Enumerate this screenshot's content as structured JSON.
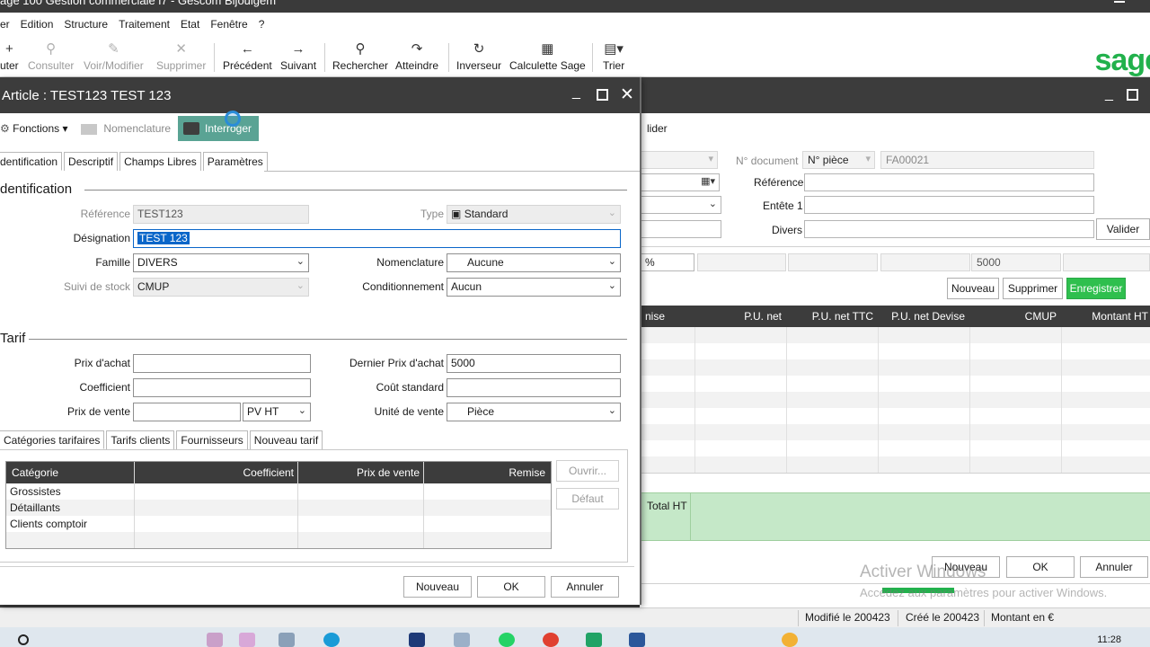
{
  "app": {
    "title": "age 100 Gestion commerciale i7 - Gescom Bijouigem"
  },
  "menu": [
    "er",
    "Edition",
    "Structure",
    "Traitement",
    "Etat",
    "Fenêtre",
    "?"
  ],
  "toolbar": {
    "items": [
      {
        "label": "uter",
        "icon": "+"
      },
      {
        "label": "Consulter",
        "icon": "⚲"
      },
      {
        "label": "Voir/Modifier",
        "icon": "✎"
      },
      {
        "label": "Supprimer",
        "icon": "✕"
      },
      {
        "label": "Précédent",
        "icon": "←"
      },
      {
        "label": "Suivant",
        "icon": "→"
      },
      {
        "label": "Rechercher",
        "icon": "⚲"
      },
      {
        "label": "Atteindre",
        "icon": "↷"
      },
      {
        "label": "Inverseur",
        "icon": "↻"
      },
      {
        "label": "Calculette Sage",
        "icon": "▦"
      },
      {
        "label": "Trier",
        "icon": "▤▾"
      }
    ],
    "logo": "sage"
  },
  "dialog": {
    "title": "Article : TEST123 TEST 123",
    "actions": {
      "fonctions": "Fonctions",
      "nomenclature": "Nomenclature",
      "interroger": "Interroger"
    },
    "tabs": [
      "dentification",
      "Descriptif",
      "Champs Libres",
      "Paramètres"
    ],
    "identification": {
      "section": "dentification",
      "reference_label": "Référence",
      "reference_value": "TEST123",
      "type_label": "Type",
      "type_value": "Standard",
      "designation_label": "Désignation",
      "designation_value": "TEST 123",
      "famille_label": "Famille",
      "famille_value": "DIVERS",
      "nomenclature_label": "Nomenclature",
      "nomenclature_value": "Aucune",
      "suivi_label": "Suivi de stock",
      "suivi_value": "CMUP",
      "conditionnement_label": "Conditionnement",
      "conditionnement_value": "Aucun"
    },
    "tarif": {
      "section": "Tarif",
      "prix_achat_label": "Prix d'achat",
      "prix_achat_value": "",
      "dernier_prix_label": "Dernier Prix d'achat",
      "dernier_prix_value": "5000",
      "coefficient_label": "Coefficient",
      "coefficient_value": "",
      "cout_label": "Coût standard",
      "cout_value": "",
      "prix_vente_label": "Prix de vente",
      "prix_vente_value": "",
      "pv_mode": "PV HT",
      "unite_label": "Unité de vente",
      "unite_value": "Pièce"
    },
    "subtabs": [
      "Catégories tarifaires",
      "Tarifs clients",
      "Fournisseurs",
      "Nouveau tarif"
    ],
    "categories": {
      "columns": [
        "Catégorie",
        "Coefficient",
        "Prix de vente",
        "Remise"
      ],
      "rows": [
        "Grossistes",
        "Détaillants",
        "Clients comptoir"
      ]
    },
    "side_buttons": {
      "ouvrir": "Ouvrir...",
      "defaut": "Défaut"
    },
    "footer": {
      "nouveau": "Nouveau",
      "ok": "OK",
      "annuler": "Annuler"
    }
  },
  "document": {
    "valider_top": "lider",
    "n_document_label": "N° document",
    "n_piece": "N° pièce",
    "n_value": "FA00021",
    "reference_label": "Référence",
    "entete_label": "Entête 1",
    "divers_label": "Divers",
    "valider_btn": "Valider",
    "pct": "%",
    "value_5000": "5000",
    "buttons": {
      "nouveau": "Nouveau",
      "supprimer": "Supprimer",
      "enregistrer": "Enregistrer"
    },
    "columns": [
      "nise",
      "P.U. net",
      "P.U. net TTC",
      "P.U. net Devise",
      "CMUP",
      "Montant HT"
    ],
    "total_label": "Total HT",
    "footer": {
      "nouveau": "Nouveau",
      "ok": "OK",
      "annuler": "Annuler"
    },
    "watermark_title": "Activer Windows",
    "watermark_sub": "Accédez aux paramètres pour activer Windows."
  },
  "status": {
    "modifie": "Modifié le 200423",
    "cree": "Créé le 200423",
    "montant": "Montant en €"
  },
  "taskbar": {
    "time": "11:28"
  }
}
